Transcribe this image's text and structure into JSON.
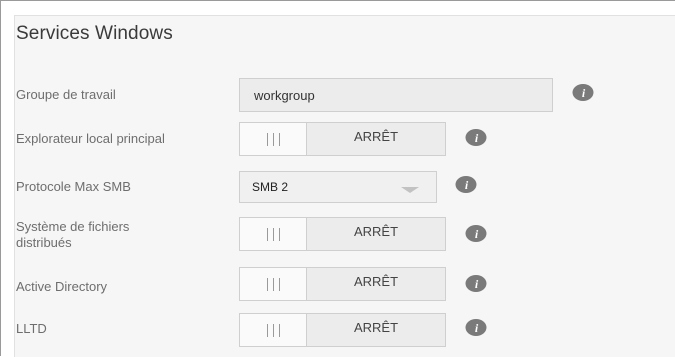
{
  "section": {
    "title": "Services Windows"
  },
  "workgroup": {
    "label": "Groupe de travail",
    "value": "workgroup"
  },
  "local_master_browser": {
    "label": "Explorateur local principal",
    "state": "ARRÊT"
  },
  "max_smb_protocol": {
    "label": "Protocole Max SMB",
    "selected": "SMB 2"
  },
  "dfs": {
    "label_line1": "Système de fichiers",
    "label_line2": "distribués",
    "state": "ARRÊT"
  },
  "active_directory": {
    "label": "Active Directory",
    "state": "ARRÊT"
  },
  "lltd": {
    "label": "LLTD",
    "state": "ARRÊT"
  },
  "icons": {
    "info": "info-icon",
    "dropdown": "chevron-down-icon",
    "toggle_grip": "grip-icon"
  },
  "colors": {
    "panel_bg": "#f6f6f6",
    "label_text": "#6e6e6e",
    "info_icon": "#7a7a7a"
  }
}
